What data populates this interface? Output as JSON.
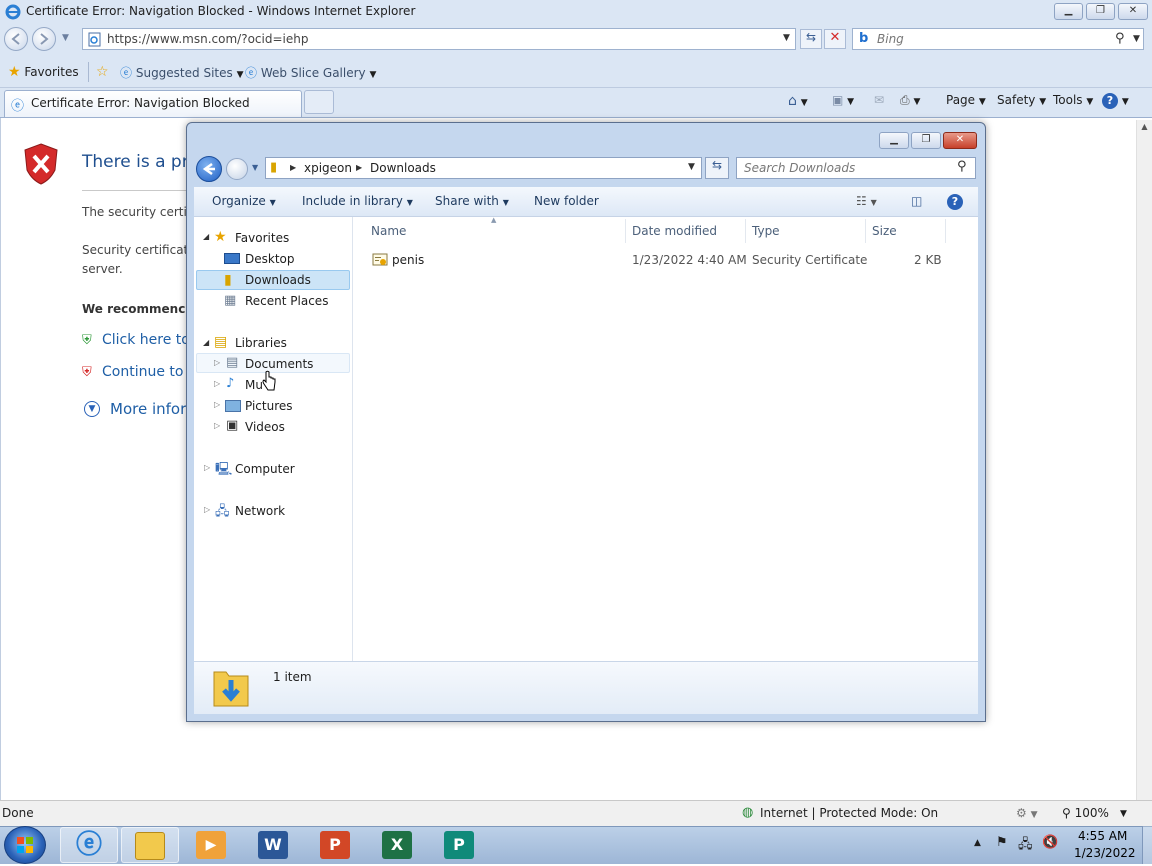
{
  "ie": {
    "title": "Certificate Error: Navigation Blocked - Windows Internet Explorer",
    "address": "https://www.msn.com/?ocid=iehp",
    "search_placeholder": "Bing",
    "favorites_label": "Favorites",
    "suggested_sites": "Suggested Sites",
    "web_slice_gallery": "Web Slice Gallery",
    "tab_title": "Certificate Error: Navigation Blocked",
    "cmd_page": "Page",
    "cmd_safety": "Safety",
    "cmd_tools": "Tools"
  },
  "page": {
    "heading": "There is a pro",
    "p1": "The security certi",
    "p2a": "Security certificat",
    "p2b": "server.",
    "recommend": "We recommenc",
    "link_close": "Click here to c",
    "link_continue": "Continue to th",
    "link_more": "More infor"
  },
  "explorer": {
    "breadcrumb": [
      "xpigeon",
      "Downloads"
    ],
    "search_placeholder": "Search Downloads",
    "toolbar": {
      "organize": "Organize",
      "include": "Include in library",
      "share": "Share with",
      "new_folder": "New folder"
    },
    "nav": {
      "favorites": "Favorites",
      "desktop": "Desktop",
      "downloads": "Downloads",
      "recent": "Recent Places",
      "libraries": "Libraries",
      "documents": "Documents",
      "music": "Mu",
      "pictures": "Pictures",
      "videos": "Videos",
      "computer": "Computer",
      "network": "Network"
    },
    "columns": {
      "name": "Name",
      "date": "Date modified",
      "type": "Type",
      "size": "Size"
    },
    "files": [
      {
        "name": "penis",
        "date": "1/23/2022 4:40 AM",
        "type": "Security Certificate",
        "size": "2 KB"
      }
    ],
    "item_count": "1 item"
  },
  "status": {
    "left": "Done",
    "zone": "Internet | Protected Mode: On",
    "zoom": "100%"
  },
  "taskbar": {
    "time": "4:55 AM",
    "date": "1/23/2022",
    "apps": [
      "start",
      "internet-explorer",
      "windows-explorer",
      "media-player",
      "word",
      "powerpoint",
      "excel",
      "publisher"
    ]
  },
  "colors": {
    "accent": "#1f4f8f",
    "selection": "#cce4f7",
    "error_red": "#d42a2a",
    "ok_green": "#2f9a3a"
  }
}
